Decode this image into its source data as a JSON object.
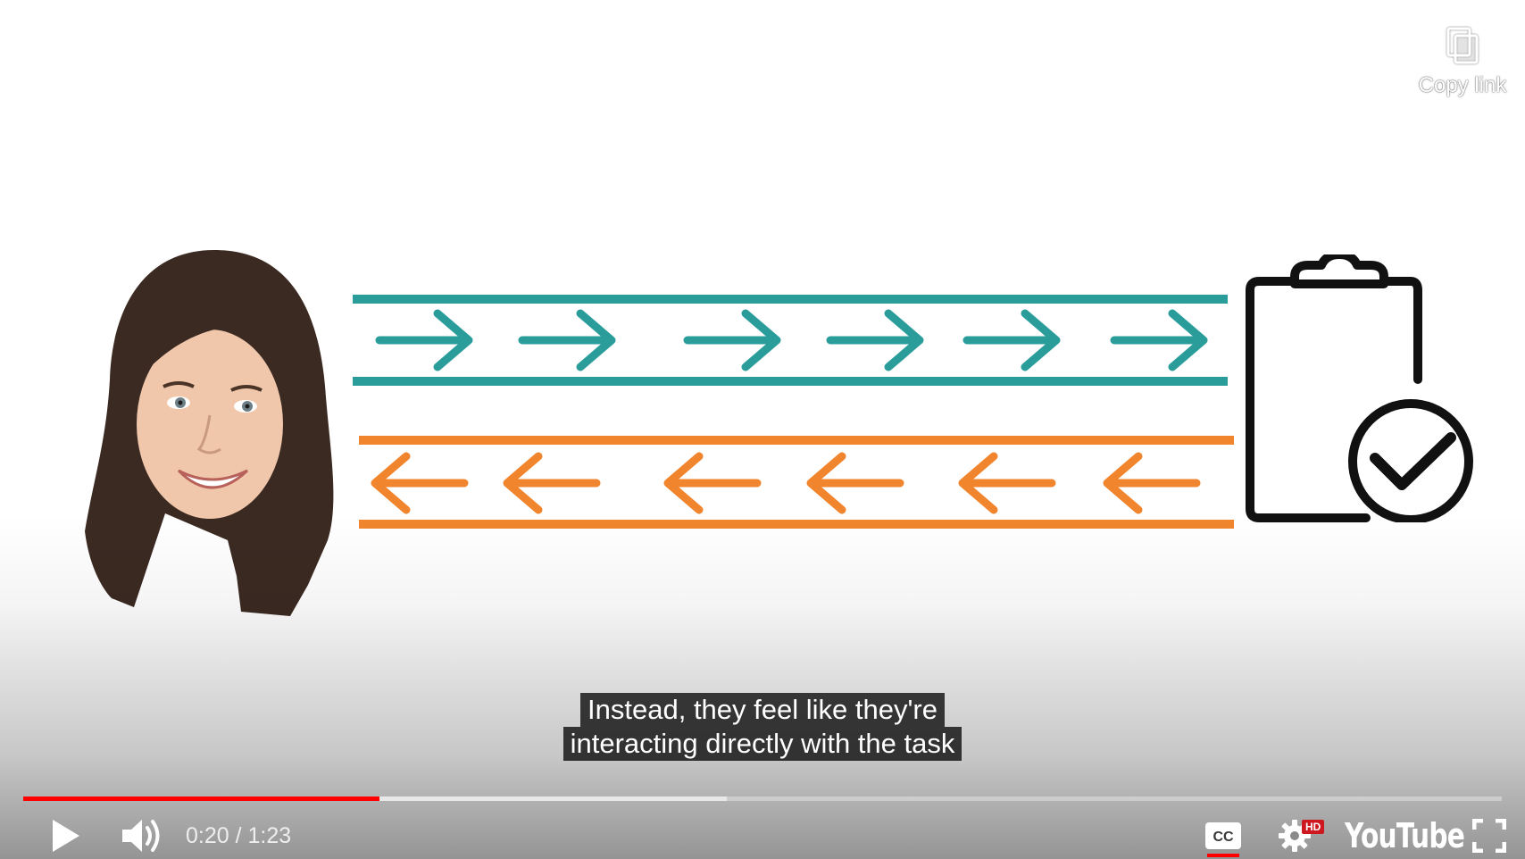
{
  "share": {
    "copy_link_label": "Copy link"
  },
  "captions": {
    "line1": "Instead, they feel like they're",
    "line2": "interacting directly with the task"
  },
  "player": {
    "current_time": "0:20",
    "duration": "1:23",
    "time_separator": " / ",
    "progress_played_fraction": 0.241,
    "progress_buffered_fraction": 0.476,
    "logo_text": "YouTube",
    "quality_badge": "HD",
    "captions_enabled": true,
    "accent_color": "#ff0000"
  },
  "illustration": {
    "top_lane_color": "#2a9d9b",
    "bottom_lane_color": "#f0852d",
    "top_lane_direction": "right",
    "bottom_lane_direction": "left",
    "arrow_count_per_lane": 6
  },
  "icons": {
    "play": "play-icon",
    "volume": "volume-icon",
    "captions": "cc-icon",
    "settings": "gear-icon",
    "fullscreen": "fullscreen-icon",
    "copy": "copy-icon"
  }
}
